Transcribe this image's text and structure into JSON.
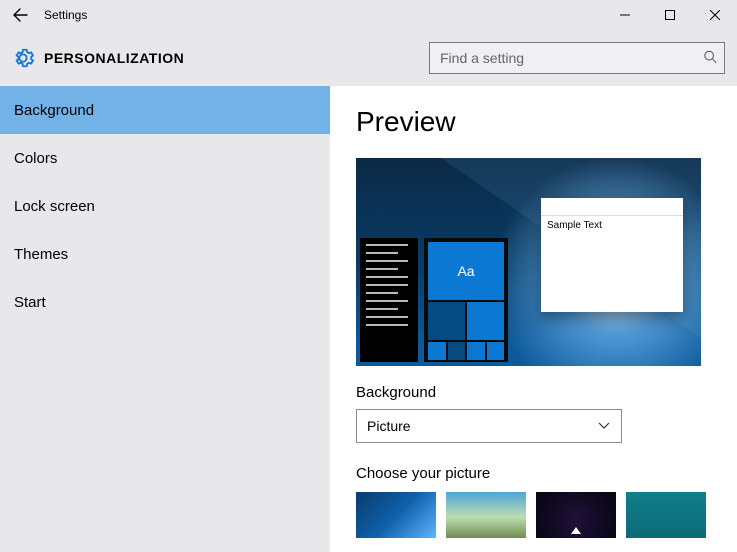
{
  "titlebar": {
    "title": "Settings"
  },
  "header": {
    "section": "PERSONALIZATION",
    "search_placeholder": "Find a setting"
  },
  "sidebar": {
    "items": [
      {
        "label": "Background",
        "selected": true
      },
      {
        "label": "Colors"
      },
      {
        "label": "Lock screen"
      },
      {
        "label": "Themes"
      },
      {
        "label": "Start"
      }
    ]
  },
  "main": {
    "preview_heading": "Preview",
    "sample_text": "Sample Text",
    "tile_glyph": "Aa",
    "background_label": "Background",
    "background_value": "Picture",
    "choose_label": "Choose your picture"
  }
}
